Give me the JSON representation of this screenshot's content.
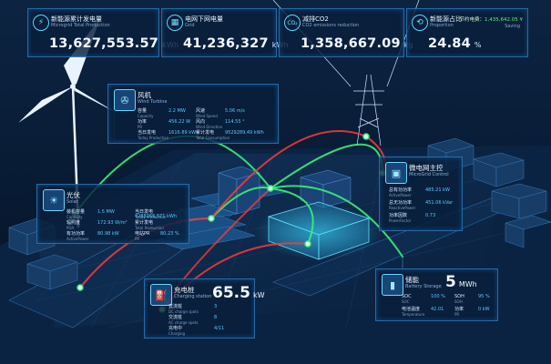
{
  "kpis": [
    {
      "icon": "lightning-icon",
      "title": "新能源累计发电量",
      "subtitle": "Microgrid Total Production",
      "value": "13,627,553.57",
      "unit": "kWh"
    },
    {
      "icon": "grid-icon",
      "title": "电网下网电量",
      "subtitle": "Grid",
      "value": "41,236,327",
      "unit": "kWh"
    },
    {
      "icon": "co2-icon",
      "title": "减排CO2",
      "subtitle": "CO2 emissions reduction",
      "value": "1,358,667.09",
      "unit": "kg"
    },
    {
      "icon": "share-icon",
      "title": "新能源占比",
      "subtitle": "Proportion",
      "value": "24.84",
      "unit": "%"
    }
  ],
  "saving": {
    "label": "节约电费：",
    "value": "1,435,642.05 ¥",
    "sublabel": "Saving"
  },
  "wind": {
    "title": "风机",
    "subtitle": "Wind Turbine",
    "items": [
      {
        "k": "容量",
        "ke": "Capacity",
        "v": "2.2 MW"
      },
      {
        "k": "风速",
        "ke": "Wind Speed",
        "v": "5.06 m/s"
      },
      {
        "k": "功率",
        "ke": "PR",
        "v": "456.22 W"
      },
      {
        "k": "风向",
        "ke": "Wind Direction",
        "v": "114.55 °"
      },
      {
        "k": "当日发电",
        "ke": "Today Production",
        "v": "1616.89 kWh"
      },
      {
        "k": "累计发电",
        "ke": "Total Consumption",
        "v": "9529289.49 kWh"
      }
    ]
  },
  "solar": {
    "title": "光伏",
    "subtitle": "Solar",
    "items": [
      {
        "k": "装机容量",
        "ke": "Capacity",
        "v": "1.5 MW"
      },
      {
        "k": "辐照度",
        "ke": "POA",
        "v": "172.93 W/m²"
      },
      {
        "k": "有功功率",
        "ke": "ActivePower",
        "v": "80.98 kW"
      },
      {
        "k": "当日发电",
        "ke": "Today Production",
        "v": ""
      },
      {
        "k": "累计发电",
        "ke": "Total Production",
        "v": "4288266.571 kWh"
      },
      {
        "k": "电站PR",
        "ke": "PR",
        "v": "80.23 %"
      }
    ]
  },
  "microgrid": {
    "title": "微电网主控",
    "subtitle": "MicroGrid Control",
    "items": [
      {
        "k": "总有功功率",
        "ke": "ActivePower",
        "v": "485.21 kW"
      },
      {
        "k": "总无功功率",
        "ke": "ReactivePower",
        "v": "451.06 kVar"
      },
      {
        "k": "功率因数",
        "ke": "PowerFactor",
        "v": "0.73"
      }
    ]
  },
  "charging": {
    "title": "充电桩",
    "subtitle": "Charging station",
    "value": "65.5",
    "unit": "kW",
    "items": [
      {
        "k": "直流桩",
        "ke": "DC charge spots",
        "v": "3"
      },
      {
        "k": "交流桩",
        "ke": "AC charge spots",
        "v": "8"
      },
      {
        "k": "充电中",
        "ke": "Charging",
        "v": "4/11"
      }
    ]
  },
  "storage": {
    "title": "储能",
    "subtitle": "Battery Storage",
    "value": "5",
    "unit": "MWh",
    "items": [
      {
        "k": "SOC",
        "ke": "SOC",
        "v": "100 %"
      },
      {
        "k": "SOH",
        "ke": "SOH",
        "v": "95 %"
      },
      {
        "k": "电池温度",
        "ke": "Temperature",
        "v": "42.01"
      },
      {
        "k": "功率",
        "ke": "PR",
        "v": "0 kW"
      }
    ]
  },
  "colors": {
    "accent": "#3ca8ff",
    "green": "#3df07a",
    "red": "#ff3a3a",
    "value": "#58c8ff"
  }
}
